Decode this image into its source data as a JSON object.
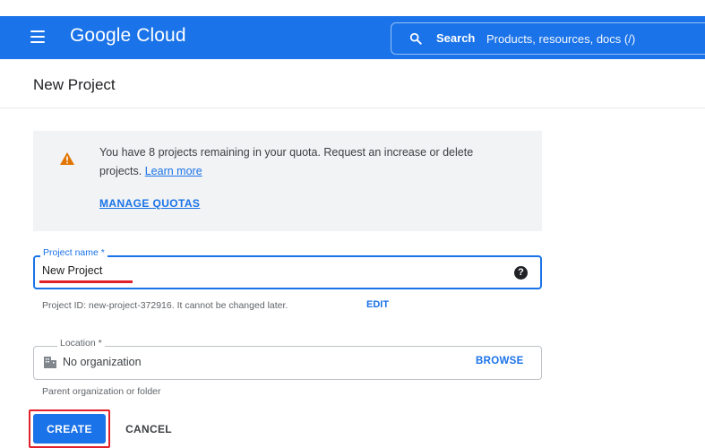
{
  "header": {
    "brand": "Google Cloud",
    "search_label": "Search",
    "search_placeholder": "Products, resources, docs (/)",
    "colors": {
      "bar": "#1a73e8"
    }
  },
  "page": {
    "title": "New Project"
  },
  "quota_notice": {
    "text": "You have 8 projects remaining in your quota. Request an increase or delete projects.",
    "learn_more": "Learn more",
    "manage_quotas": "MANAGE QUOTAS",
    "icon": "warning-icon"
  },
  "project_name": {
    "label": "Project name *",
    "value": "New Project",
    "help_icon": "help-icon"
  },
  "project_id": {
    "text": "Project ID: new-project-372916. It cannot be changed later.",
    "edit": "EDIT"
  },
  "location": {
    "label": "Location *",
    "value": "No organization",
    "browse": "BROWSE",
    "helper": "Parent organization or folder",
    "icon": "building-icon"
  },
  "actions": {
    "create": "CREATE",
    "cancel": "CANCEL",
    "highlight_color": "#e0202a"
  }
}
